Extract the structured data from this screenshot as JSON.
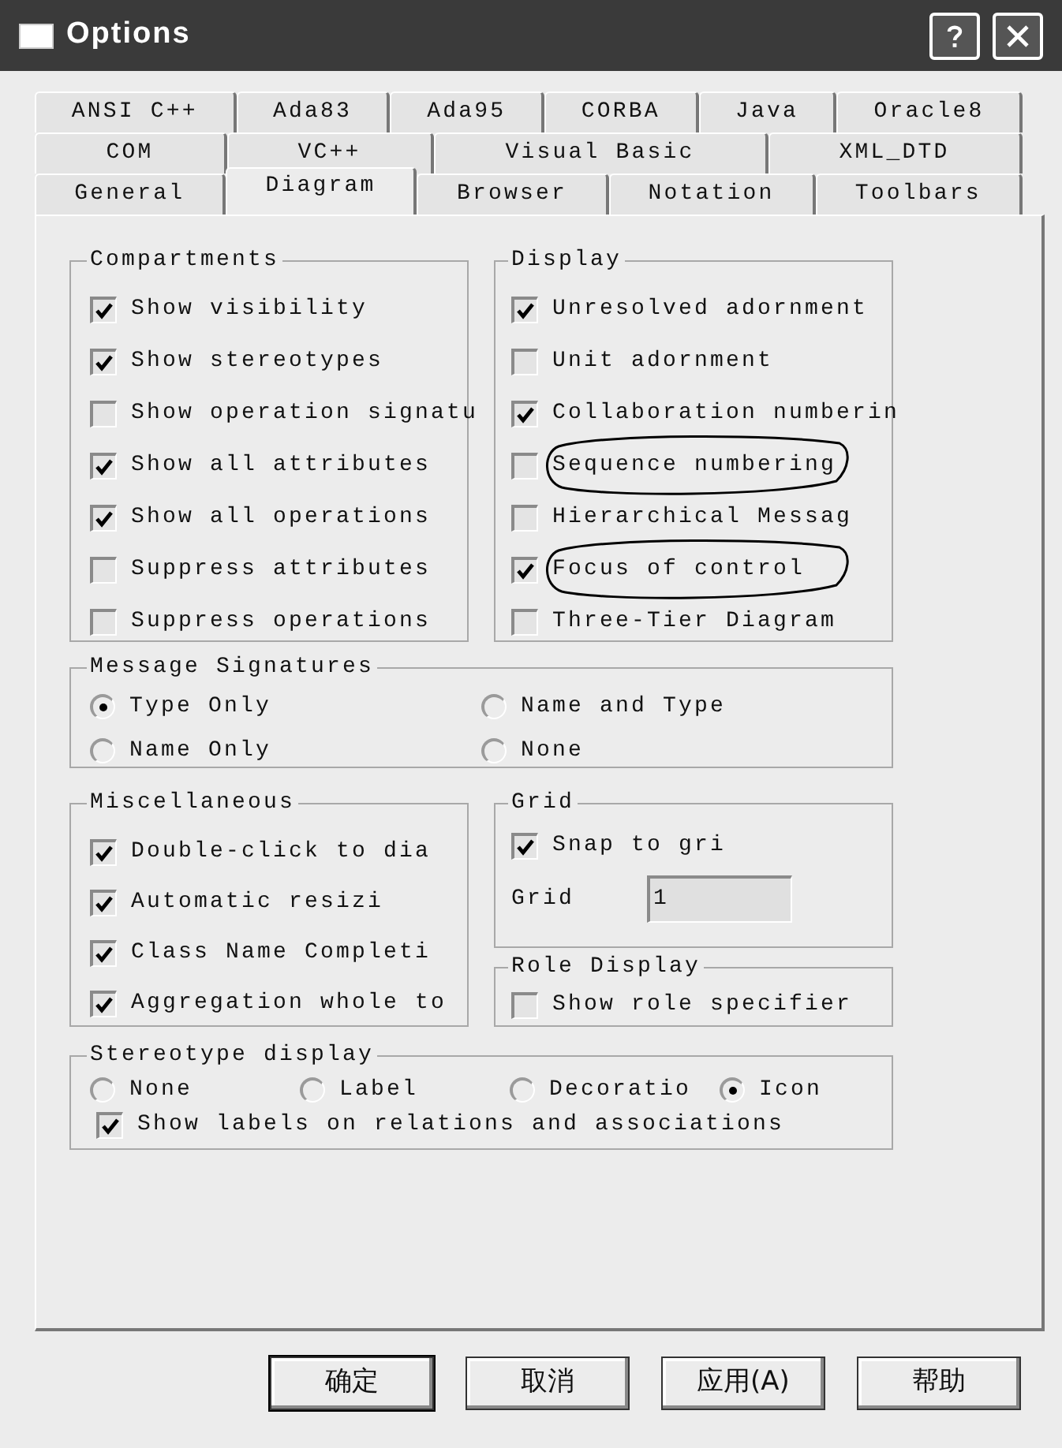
{
  "window": {
    "title": "Options"
  },
  "tab_rows": [
    [
      {
        "label": "ANSI C++",
        "selected": false
      },
      {
        "label": "Ada83",
        "selected": false
      },
      {
        "label": "Ada95",
        "selected": false
      },
      {
        "label": "CORBA",
        "selected": false
      },
      {
        "label": "Java",
        "selected": false
      },
      {
        "label": "Oracle8",
        "selected": false
      }
    ],
    [
      {
        "label": "COM",
        "selected": false
      },
      {
        "label": "VC++",
        "selected": false
      },
      {
        "label": "Visual Basic",
        "selected": false
      },
      {
        "label": "XML_DTD",
        "selected": false
      }
    ],
    [
      {
        "label": "General",
        "selected": false
      },
      {
        "label": "Diagram",
        "selected": true
      },
      {
        "label": "Browser",
        "selected": false
      },
      {
        "label": "Notation",
        "selected": false
      },
      {
        "label": "Toolbars",
        "selected": false
      }
    ]
  ],
  "compartments": {
    "title": "Compartments",
    "items": [
      {
        "label": "Show visibility",
        "checked": true
      },
      {
        "label": "Show stereotypes",
        "checked": true
      },
      {
        "label": "Show operation signatu",
        "checked": false
      },
      {
        "label": "Show all attributes",
        "checked": true
      },
      {
        "label": "Show all operations",
        "checked": true
      },
      {
        "label": "Suppress attributes",
        "checked": false
      },
      {
        "label": "Suppress operations",
        "checked": false
      }
    ]
  },
  "display": {
    "title": "Display",
    "items": [
      {
        "label": "Unresolved adornment",
        "checked": true,
        "circled": false
      },
      {
        "label": "Unit adornment",
        "checked": false,
        "circled": false
      },
      {
        "label": "Collaboration numberin",
        "checked": true,
        "circled": false
      },
      {
        "label": "Sequence numbering",
        "checked": false,
        "circled": true
      },
      {
        "label": "Hierarchical Messag",
        "checked": false,
        "circled": false
      },
      {
        "label": "Focus of control",
        "checked": true,
        "circled": true
      },
      {
        "label": "Three-Tier Diagram",
        "checked": false,
        "circled": false
      }
    ]
  },
  "message_signatures": {
    "title": "Message Signatures",
    "options": [
      {
        "label": "Type Only",
        "selected": true
      },
      {
        "label": "Name and Type",
        "selected": false
      },
      {
        "label": "Name Only",
        "selected": false
      },
      {
        "label": "None",
        "selected": false
      }
    ]
  },
  "miscellaneous": {
    "title": "Miscellaneous",
    "items": [
      {
        "label": "Double-click to dia",
        "checked": true
      },
      {
        "label": "Automatic resizi",
        "checked": true
      },
      {
        "label": "Class Name Completi",
        "checked": true
      },
      {
        "label": "Aggregation whole to",
        "checked": true
      }
    ]
  },
  "grid": {
    "title": "Grid",
    "snap": {
      "label": "Snap to gri",
      "checked": true
    },
    "size_label": "Grid",
    "size_value": "1"
  },
  "role_display": {
    "title": "Role Display",
    "items": [
      {
        "label": "Show role specifier",
        "checked": false
      }
    ]
  },
  "stereotype_display": {
    "title": "Stereotype display",
    "options": [
      {
        "label": "None",
        "selected": false
      },
      {
        "label": "Label",
        "selected": false
      },
      {
        "label": "Decoratio",
        "selected": false
      },
      {
        "label": "Icon",
        "selected": true
      }
    ],
    "show_labels": {
      "label": "Show labels on relations and associations",
      "checked": true
    }
  },
  "buttons": [
    {
      "label": "确定"
    },
    {
      "label": "取消"
    },
    {
      "label": "应用(A)"
    },
    {
      "label": "帮助"
    }
  ]
}
